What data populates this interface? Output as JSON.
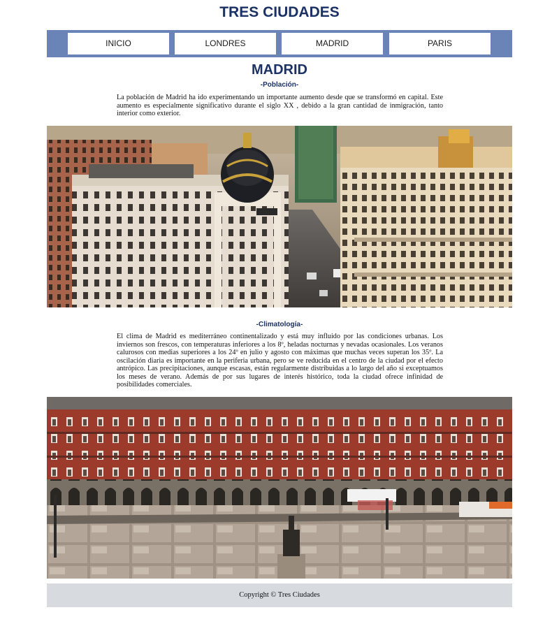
{
  "site": {
    "title": "TRES CIUDADES"
  },
  "nav": {
    "items": [
      "INICIO",
      "LONDRES",
      "MADRID",
      "PARIS"
    ]
  },
  "page": {
    "heading": "MADRID",
    "sections": [
      {
        "heading": "-Población-",
        "text": "La población de Madrid ha ido experimentando un importante aumento desde que se transformó en capital. Este aumento es especialmente significativo durante el siglo XX , debido a la gran cantidad de inmigración, tanto interior como exterior."
      },
      {
        "heading": "-Climatología-",
        "text": "El clima de Madrid es mediterráneo continentalizado y está muy influido por las condiciones urbanas. Los inviernos son frescos, con temperaturas inferiores a los 8º, heladas nocturnas y nevadas ocasionales. Los veranos calurosos con medias superiores a los 24º en julio y agosto con máximas que muchas veces superan los 35º. La oscilación diaria es importante en la periferia urbana, pero se ve reducida en el centro de la ciudad por el efecto antrópico. Las precipitaciones, aunque escasas, están regularmente distribuidas a lo largo del año si exceptuamos los meses de verano. Además de por sus lugares de interés histórico, toda la ciudad ofrece infinidad de posibilidades comerciales."
      }
    ]
  },
  "footer": {
    "text": "Copyright © Tres Ciudades"
  },
  "colors": {
    "title": "#1c3266",
    "nav_bar": "#6b84b8",
    "footer_bg": "#d7dbe0"
  }
}
